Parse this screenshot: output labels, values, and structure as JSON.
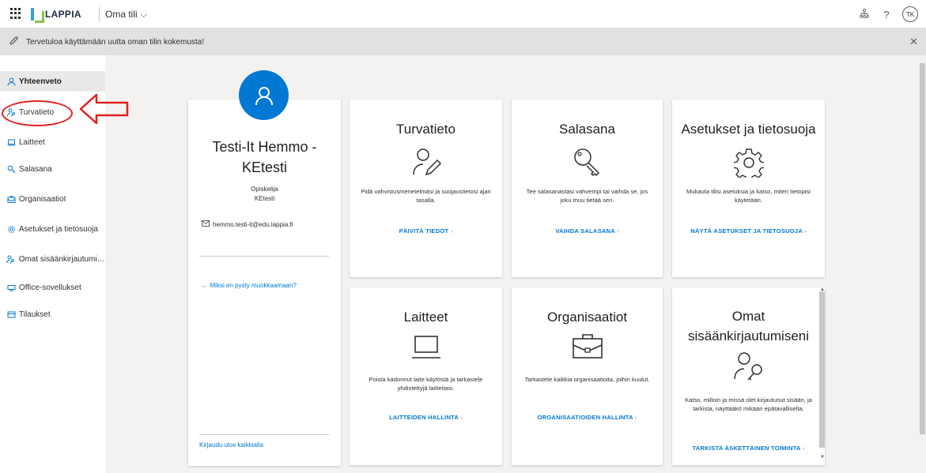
{
  "topbar": {
    "brand": "LAPPIA",
    "app_name": "Oma tili",
    "app_chevron": "⌵",
    "avatar_initials": "TK",
    "icons": [
      "org-chart-icon",
      "help-icon"
    ]
  },
  "banner": {
    "text": "Tervetuloa käyttämään uutta oman tilin kokemusta!",
    "icon": "rocket-icon"
  },
  "sidebar": {
    "items": [
      {
        "label": "Yhteenveto",
        "icon": "person-icon",
        "active": true
      },
      {
        "label": "Turvatieto",
        "icon": "person-key-icon",
        "active": false
      },
      {
        "label": "Laitteet",
        "icon": "laptop-icon",
        "active": false
      },
      {
        "label": "Salasana",
        "icon": "key-icon",
        "active": false
      },
      {
        "label": "Organisaatiot",
        "icon": "briefcase-icon",
        "active": false
      },
      {
        "label": "Asetukset ja tietosuoja",
        "icon": "gear-icon",
        "active": false
      },
      {
        "label": "Omat sisäänkirjautumis...",
        "icon": "person-key-icon",
        "active": false
      },
      {
        "label": "Office-sovellukset",
        "icon": "apps-icon",
        "active": false
      },
      {
        "label": "Tilaukset",
        "icon": "card-icon",
        "active": false
      }
    ]
  },
  "profile": {
    "name": "Testi-It Hemmo - KEtesti",
    "role": "Opiskelija",
    "org": "KEtesti",
    "email": "hemmo.testi-it@edu.lappia.fi",
    "why_link": "Miksi en pysty muokkaamaan?",
    "signout_link": "Kirjaudu ulos kaikkialla"
  },
  "tiles": [
    {
      "title": "Turvatieto",
      "icon": "person-pen-icon",
      "desc": "Pidä vahvistusmenetelmäsi ja suojaustietosi ajan tasalla.",
      "link": "PÄIVITÄ TIEDOT"
    },
    {
      "title": "Salasana",
      "icon": "key-icon",
      "desc": "Tee salasanastasi vahvempi tai vaihda se, jos joku muu tietää sen.",
      "link": "VAIHDA SALASANA"
    },
    {
      "title": "Asetukset ja tietosuoja",
      "icon": "gear-icon",
      "desc": "Mukauta tilisi asetuksia ja katso, miten tietojasi käytetään.",
      "link": "NÄYTÄ ASETUKSET JA TIETOSUOJA"
    },
    {
      "title": "Laitteet",
      "icon": "laptop-icon",
      "desc": "Poista kadonnut laite käytöstä ja tarkastele yhdistettyjä laitteitasi.",
      "link": "LAITTEIDEN HALLINTA"
    },
    {
      "title": "Organisaatiot",
      "icon": "briefcase-icon",
      "desc": "Tarkastele kaikkia organisaatioita, joihin kuulut.",
      "link": "ORGANISAATIOIDEN HALLINTA"
    },
    {
      "title_line1": "Omat",
      "title_line2": "sisäänkirjautumiseni",
      "icon": "person-key-icon",
      "desc": "Katso, milloin ja missä olet kirjautunut sisään, ja tarkista, näyttääkö mikään epätavalliselta.",
      "link": "TARKISTA ÄSKETTÄINEN TOIMINTA"
    }
  ],
  "colors": {
    "accent": "#0078d4",
    "annotation": "#e02020",
    "banner_bg": "#e1e1e1"
  }
}
